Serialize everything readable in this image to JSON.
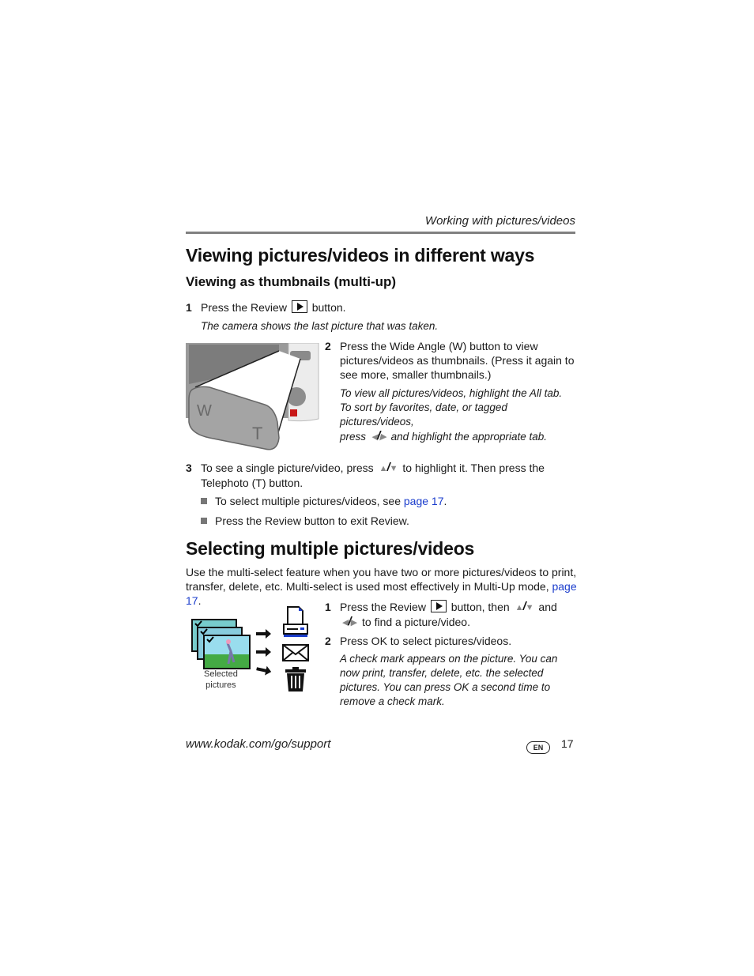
{
  "header": {
    "running_head": "Working with pictures/videos"
  },
  "section1": {
    "title": "Viewing pictures/videos in different ways",
    "subtitle": "Viewing as thumbnails (multi-up)",
    "steps": [
      {
        "num": "1",
        "text_before": "Press the Review",
        "icon": "review-play-icon",
        "text_after": "button.",
        "note": "The camera shows the last picture that was taken."
      },
      {
        "num": "2",
        "text": "Press the Wide Angle (W) button to view pictures/videos as thumbnails. (Press it again to see more, smaller thumbnails.)",
        "note_line1": "To view all pictures/videos, highlight the All tab.",
        "note_line2": "To sort by favorites, date, or tagged pictures/videos,",
        "note_line3_before": "press",
        "note_line3_after": "and highlight the appropriate tab."
      },
      {
        "num": "3",
        "text_before": "To see a single picture/video, press",
        "text_after": "to highlight it. Then press the Telephoto (T) button."
      }
    ],
    "bullets": [
      {
        "text_before": "To select multiple pictures/videos, see ",
        "link": "page 17",
        "text_after": "."
      },
      {
        "text": "Press the Review button to exit Review."
      }
    ],
    "image_labels": {
      "w": "W",
      "t": "T"
    }
  },
  "section2": {
    "title": "Selecting multiple pictures/videos",
    "intro_before": "Use the multi-select feature when you have two or more pictures/videos to print, transfer, delete, etc. Multi-select is used most effectively in Multi-Up mode, ",
    "intro_link": "page 17",
    "intro_after": ".",
    "image_caption_line1": "Selected",
    "image_caption_line2": "pictures",
    "steps": [
      {
        "num": "1",
        "text_before": "Press the Review",
        "text_mid": "button, then",
        "text_and": "and",
        "text_after": "to find a picture/video."
      },
      {
        "num": "2",
        "text": "Press OK to select pictures/videos.",
        "note": "A check mark appears on the picture. You can now print, transfer, delete, etc. the selected pictures. You can press OK a second time to remove a check mark."
      }
    ]
  },
  "footer": {
    "url": "www.kodak.com/go/support",
    "language_badge": "EN",
    "page_number": "17"
  },
  "colors": {
    "link": "#1a3ccc",
    "rule": "#808080"
  }
}
